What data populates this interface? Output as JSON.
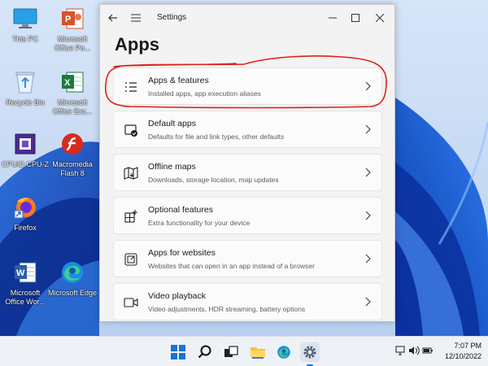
{
  "desktop": {
    "icons": [
      {
        "label": "This PC"
      },
      {
        "label": "Microsoft Office Po..."
      },
      {
        "label": "Recycle Bin"
      },
      {
        "label": "Microsoft Office Exc..."
      },
      {
        "label": "CPUID CPU-Z"
      },
      {
        "label": "Macromedia Flash 8"
      },
      {
        "label": "Firefox"
      },
      {
        "label": "Microsoft Office Wor..."
      },
      {
        "label": "Microsoft Edge"
      }
    ]
  },
  "window": {
    "title": "Settings",
    "page_title": "Apps",
    "items": [
      {
        "title": "Apps & features",
        "subtitle": "Installed apps, app execution aliases",
        "icon": "apps-features-icon"
      },
      {
        "title": "Default apps",
        "subtitle": "Defaults for file and link types, other defaults",
        "icon": "default-apps-icon"
      },
      {
        "title": "Offline maps",
        "subtitle": "Downloads, storage location, map updates",
        "icon": "offline-maps-icon"
      },
      {
        "title": "Optional features",
        "subtitle": "Extra functionality for your device",
        "icon": "optional-features-icon"
      },
      {
        "title": "Apps for websites",
        "subtitle": "Websites that can open in an app instead of a browser",
        "icon": "apps-websites-icon"
      },
      {
        "title": "Video playback",
        "subtitle": "Video adjustments, HDR streaming, battery options",
        "icon": "video-playback-icon"
      }
    ],
    "annotation_color": "#e0201b"
  },
  "taskbar": {
    "time": "7:07 PM",
    "date": "12/10/2022"
  }
}
